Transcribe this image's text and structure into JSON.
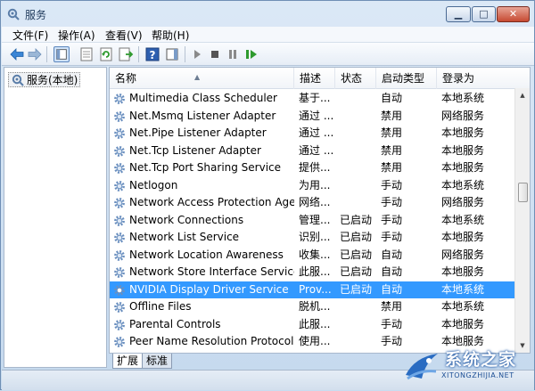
{
  "window": {
    "title": "服务"
  },
  "menu": [
    "文件(F)",
    "操作(A)",
    "查看(V)",
    "帮助(H)"
  ],
  "toolbar": {
    "buttons": [
      "back-icon",
      "forward-icon",
      "show-hide-tree-icon",
      "properties-icon",
      "refresh-icon",
      "export-list-icon",
      "help-icon",
      "show-hide-action-pane-icon",
      "start-service-icon",
      "stop-service-icon",
      "pause-service-icon",
      "restart-service-icon"
    ]
  },
  "tree": {
    "item": "服务(本地)"
  },
  "columns": {
    "name": "名称",
    "desc": "描述",
    "status": "状态",
    "start": "启动类型",
    "logon": "登录为"
  },
  "services": [
    {
      "name": "Multimedia Class Scheduler",
      "desc": "基于...",
      "status": "",
      "start": "自动",
      "logon": "本地系统"
    },
    {
      "name": "Net.Msmq Listener Adapter",
      "desc": "通过 ...",
      "status": "",
      "start": "禁用",
      "logon": "网络服务"
    },
    {
      "name": "Net.Pipe Listener Adapter",
      "desc": "通过 ...",
      "status": "",
      "start": "禁用",
      "logon": "本地服务"
    },
    {
      "name": "Net.Tcp Listener Adapter",
      "desc": "通过 ...",
      "status": "",
      "start": "禁用",
      "logon": "本地服务"
    },
    {
      "name": "Net.Tcp Port Sharing Service",
      "desc": "提供...",
      "status": "",
      "start": "禁用",
      "logon": "本地服务"
    },
    {
      "name": "Netlogon",
      "desc": "为用...",
      "status": "",
      "start": "手动",
      "logon": "本地系统"
    },
    {
      "name": "Network Access Protection Agent",
      "desc": "网络...",
      "status": "",
      "start": "手动",
      "logon": "网络服务"
    },
    {
      "name": "Network Connections",
      "desc": "管理...",
      "status": "已启动",
      "start": "手动",
      "logon": "本地系统"
    },
    {
      "name": "Network List Service",
      "desc": "识别...",
      "status": "已启动",
      "start": "手动",
      "logon": "本地服务"
    },
    {
      "name": "Network Location Awareness",
      "desc": "收集...",
      "status": "已启动",
      "start": "自动",
      "logon": "网络服务"
    },
    {
      "name": "Network Store Interface Service",
      "desc": "此服...",
      "status": "已启动",
      "start": "自动",
      "logon": "本地服务"
    },
    {
      "name": "NVIDIA Display Driver Service",
      "desc": "Prov...",
      "status": "已启动",
      "start": "自动",
      "logon": "本地系统",
      "selected": true
    },
    {
      "name": "Offline Files",
      "desc": "脱机...",
      "status": "",
      "start": "禁用",
      "logon": "本地系统"
    },
    {
      "name": "Parental Controls",
      "desc": "此服...",
      "status": "",
      "start": "手动",
      "logon": "本地服务"
    },
    {
      "name": "Peer Name Resolution Protocol",
      "desc": "使用...",
      "status": "",
      "start": "手动",
      "logon": "本地服务"
    }
  ],
  "tabs": [
    "扩展",
    "标准"
  ],
  "watermark": {
    "main": "系统之家",
    "sub": "XITONGZHIJIA.NET"
  },
  "colors": {
    "selection": "#3399ff",
    "gear": "#6a8fbf"
  }
}
